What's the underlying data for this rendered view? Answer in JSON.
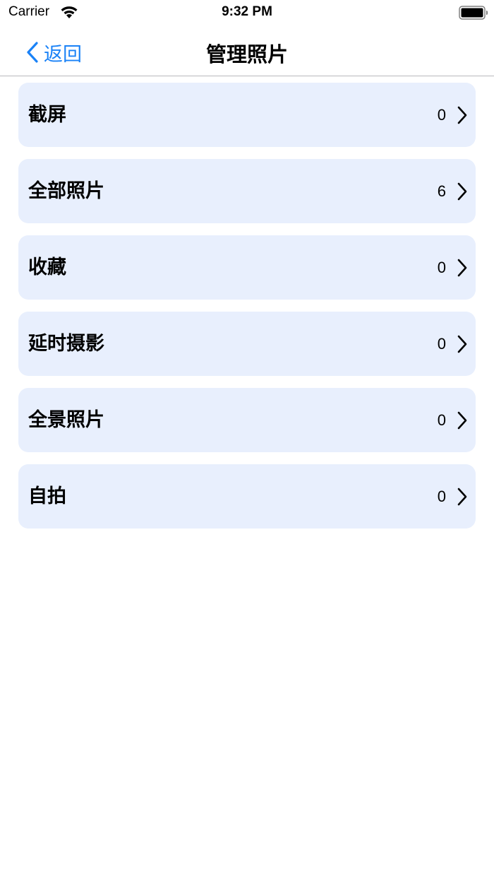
{
  "status_bar": {
    "carrier": "Carrier",
    "time": "9:32 PM",
    "icons": [
      "wifi-icon",
      "battery-icon"
    ]
  },
  "nav": {
    "back_label": "返回",
    "title": "管理照片",
    "accent_color": "#1a82f7"
  },
  "albums": [
    {
      "label": "截屏",
      "count": "0"
    },
    {
      "label": "全部照片",
      "count": "6"
    },
    {
      "label": "收藏",
      "count": "0"
    },
    {
      "label": "延时摄影",
      "count": "0"
    },
    {
      "label": "全景照片",
      "count": "0"
    },
    {
      "label": "自拍",
      "count": "0"
    }
  ],
  "colors": {
    "item_background": "#e8effd",
    "separator": "#b8b8bc"
  }
}
